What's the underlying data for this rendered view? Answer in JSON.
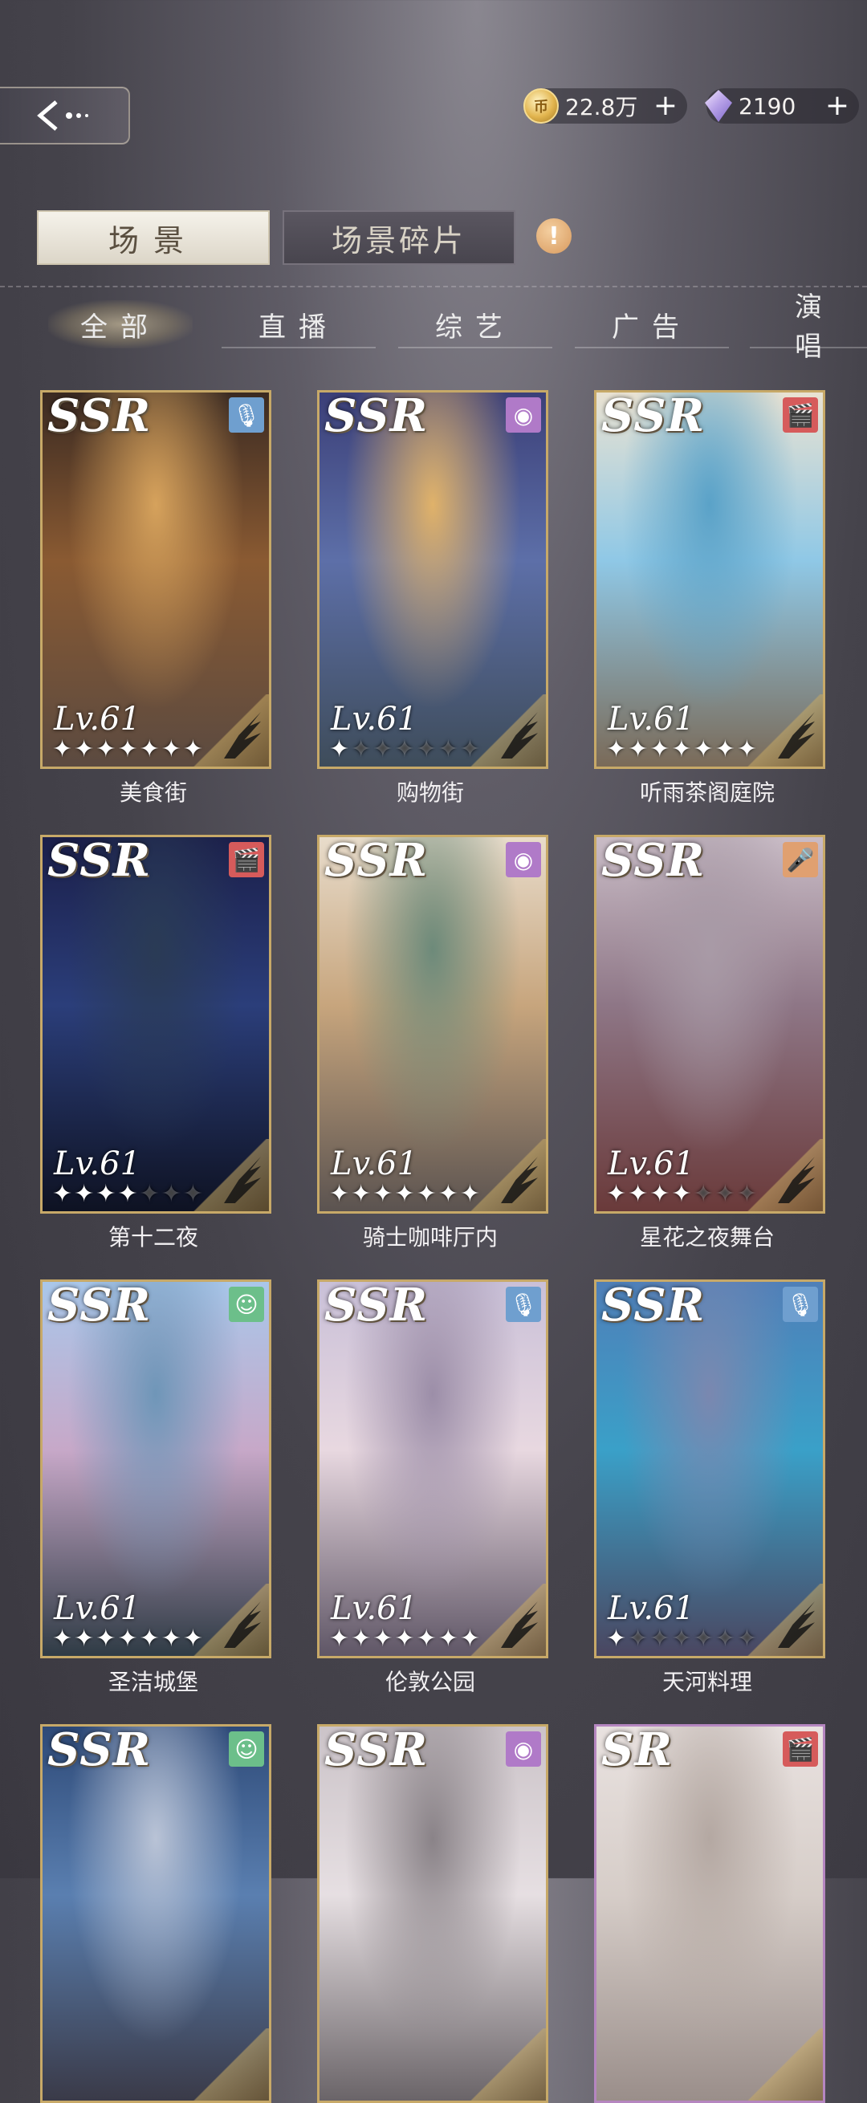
{
  "header": {
    "coins": "22.8万",
    "gems": "2190",
    "plus": "+",
    "coin_glyph": "币"
  },
  "tabs": {
    "scene": "场景",
    "fragment": "场景碎片",
    "info": "!"
  },
  "categories": [
    "全部",
    "直播",
    "综艺",
    "广告",
    "演唱"
  ],
  "cards": [
    {
      "name": "美食街",
      "rarity": "SSR",
      "level": "Lv.61",
      "stars": 7,
      "filled": 7,
      "type": "mic",
      "type_color": "#6f9fcf",
      "art": [
        "#3a2a22",
        "#8a5a32",
        "#d6a25c",
        "#5b4a40"
      ]
    },
    {
      "name": "购物街",
      "rarity": "SSR",
      "level": "Lv.61",
      "stars": 7,
      "filled": 1,
      "type": "circle",
      "type_color": "#b07ac8",
      "art": [
        "#3b3f78",
        "#5d6fa8",
        "#e0b26a",
        "#3e4c5a"
      ]
    },
    {
      "name": "听雨茶阁庭院",
      "rarity": "SSR",
      "level": "Lv.61",
      "stars": 7,
      "filled": 7,
      "type": "clapper",
      "type_color": "#d65b5b",
      "art": [
        "#e9e2d2",
        "#8fc8e6",
        "#5aa2c8",
        "#7a6a58"
      ]
    },
    {
      "name": "第十二夜",
      "rarity": "SSR",
      "level": "Lv.61",
      "stars": 7,
      "filled": 4,
      "type": "clapper",
      "type_color": "#d65b5b",
      "art": [
        "#1b1f4a",
        "#2b3e7a",
        "#2a3b55",
        "#0e1222"
      ]
    },
    {
      "name": "骑士咖啡厅内",
      "rarity": "SSR",
      "level": "Lv.61",
      "stars": 7,
      "filled": 7,
      "type": "circle",
      "type_color": "#b07ac8",
      "art": [
        "#e8dccb",
        "#c7a57d",
        "#6d8a7a",
        "#5b5350"
      ]
    },
    {
      "name": "星花之夜舞台",
      "rarity": "SSR",
      "level": "Lv.61",
      "stars": 7,
      "filled": 4,
      "type": "mic2",
      "type_color": "#e0a070",
      "art": [
        "#c9bcc6",
        "#8e7686",
        "#a89aa6",
        "#6a3a3a"
      ]
    },
    {
      "name": "圣洁城堡",
      "rarity": "SSR",
      "level": "Lv.61",
      "stars": 7,
      "filled": 7,
      "type": "smile",
      "type_color": "#6cbf8a",
      "art": [
        "#a9c7ea",
        "#c7a8c8",
        "#6f96b8",
        "#2f3b45"
      ]
    },
    {
      "name": "伦敦公园",
      "rarity": "SSR",
      "level": "Lv.61",
      "stars": 7,
      "filled": 7,
      "type": "mic",
      "type_color": "#6f9fcf",
      "art": [
        "#c9c0d8",
        "#e8d8e0",
        "#9c8ea8",
        "#5f5666"
      ]
    },
    {
      "name": "天河料理",
      "rarity": "SSR",
      "level": "Lv.61",
      "stars": 7,
      "filled": 1,
      "type": "mic",
      "type_color": "#6f9fcf",
      "art": [
        "#4f7fb8",
        "#3aa0c8",
        "#7a88b0",
        "#4a4660"
      ]
    },
    {
      "name": "",
      "rarity": "SSR",
      "level": "",
      "stars": 0,
      "filled": 0,
      "type": "smile",
      "type_color": "#6cbf8a",
      "art": [
        "#2e4a78",
        "#5a7fb0",
        "#b9c3d6",
        "#3a3a48"
      ]
    },
    {
      "name": "",
      "rarity": "SSR",
      "level": "",
      "stars": 0,
      "filled": 0,
      "type": "circle",
      "type_color": "#b07ac8",
      "art": [
        "#cbc3c8",
        "#e6dfe2",
        "#8a8388",
        "#6a6468"
      ]
    },
    {
      "name": "",
      "rarity": "SR",
      "level": "",
      "stars": 0,
      "filled": 0,
      "type": "clapper",
      "type_color": "#d65b5b",
      "art": [
        "#e9e2e0",
        "#d6cdc8",
        "#b4a8a2",
        "#9a8e8a"
      ]
    }
  ]
}
